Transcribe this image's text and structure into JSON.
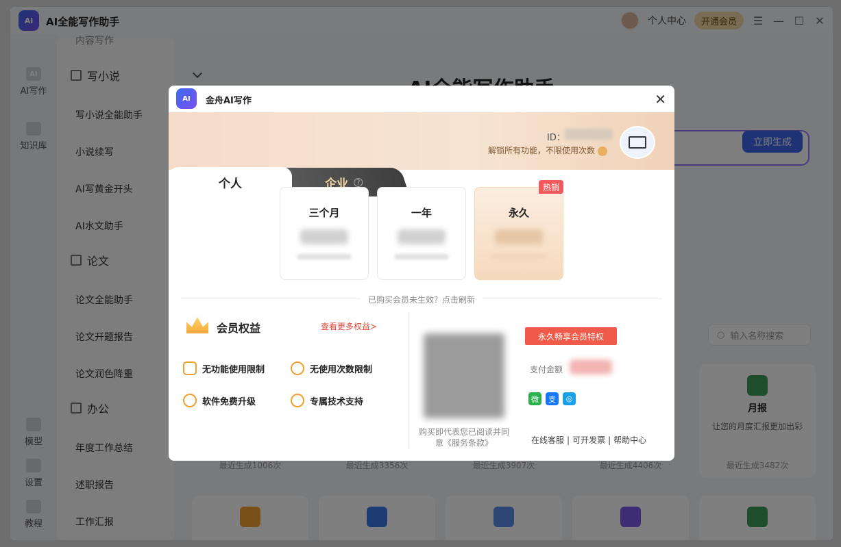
{
  "app": {
    "title": "AI全能写作助手",
    "logo_text": "AI",
    "user_center": "个人中心",
    "vip_button": "开通会员",
    "window_controls": [
      "☰",
      "—",
      "☐",
      "✕"
    ]
  },
  "rail": {
    "items": [
      {
        "label": "AI写作",
        "icon": "ai-icon"
      },
      {
        "label": "知识库",
        "icon": "book-icon"
      },
      {
        "label": "模型",
        "icon": "cloud-icon"
      },
      {
        "label": "设置",
        "icon": "gear-icon"
      },
      {
        "label": "教程",
        "icon": "help-icon"
      }
    ]
  },
  "sidebar": {
    "top_cut": "内容写作",
    "groups": [
      {
        "label": "写小说",
        "items": [
          "写小说全能助手",
          "小说续写",
          "AI写黄金开头",
          "AI水文助手"
        ]
      },
      {
        "label": "论文",
        "items": [
          "论文全能助手",
          "论文开题报告",
          "论文润色降重"
        ]
      },
      {
        "label": "办公",
        "items": [
          "年度工作总结",
          "述职报告",
          "工作汇报"
        ]
      }
    ]
  },
  "main": {
    "title": "AI全能写作助手",
    "generate_button": "立即生成",
    "search_placeholder": "输入名称搜索",
    "cards": [
      {
        "title": "月报",
        "desc": "让您的月度汇报更加出彩",
        "count": "最近生成3482次"
      }
    ],
    "card_counts": [
      "最近生成1006次",
      "最近生成3356次",
      "最近生成3907次",
      "最近生成4406次"
    ]
  },
  "modal": {
    "logo_text": "AI",
    "title": "金舟AI写作",
    "close": "✕",
    "id_label": "ID：",
    "unlock_text": "解锁所有功能，不限使用次数",
    "tabs": {
      "personal": "个人",
      "business": "企业",
      "help": "?"
    },
    "plans": [
      {
        "name": "三个月"
      },
      {
        "name": "一年"
      },
      {
        "name": "永久",
        "badge": "热销"
      }
    ],
    "refresh_text": "已购买会员未生效？点击刷新",
    "benefits": {
      "title": "会员权益",
      "more": "查看更多权益>",
      "items": [
        "无功能使用限制",
        "无使用次数限制",
        "软件免费升级",
        "专属技术支持"
      ]
    },
    "agree_text": "购买即代表您已阅读并同意《服务条款》",
    "perk_button": "永久畅享会员特权",
    "pay_label": "支付金额",
    "pay_methods": [
      {
        "icon": "wechat-pay-icon",
        "glyph": "微",
        "color": "#2bb24c"
      },
      {
        "icon": "alipay-icon",
        "glyph": "支",
        "color": "#1677ff"
      },
      {
        "icon": "other-pay-icon",
        "glyph": "◎",
        "color": "#1aa0e8"
      }
    ],
    "links": [
      "在线客服",
      "可开发票",
      "帮助中心"
    ]
  }
}
